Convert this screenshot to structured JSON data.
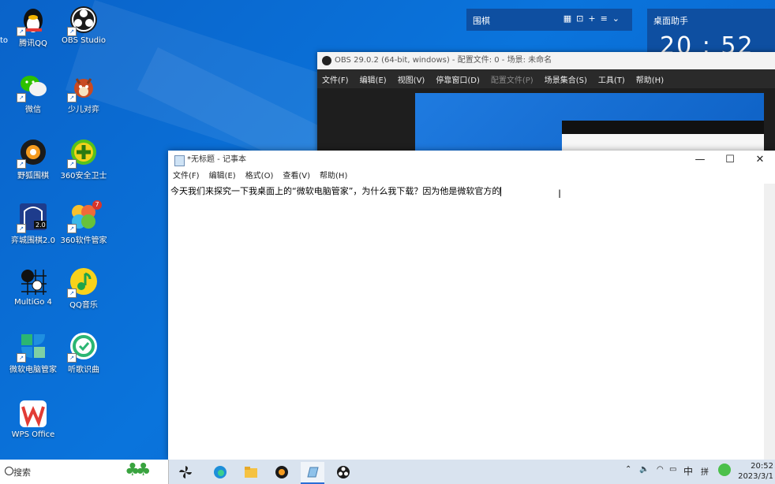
{
  "desktop": {
    "icons": [
      {
        "label": "腾讯QQ",
        "color": "#000000"
      },
      {
        "label": "OBS Studio",
        "color": "#2b2b2b"
      },
      {
        "label": "微信",
        "color": "#2dc100"
      },
      {
        "label": "少儿对弈",
        "color": "#c84a22"
      },
      {
        "label": "野狐围棋",
        "color": "#1b1b1b"
      },
      {
        "label": "360安全卫士",
        "color": "#57c21b"
      },
      {
        "label": "弈城围棋2.0",
        "color": "#1e3c8c"
      },
      {
        "label": "360软件管家",
        "color": "#ef6a3a"
      },
      {
        "label": "MultiGo 4",
        "color": "#ffffff"
      },
      {
        "label": "QQ音乐",
        "color": "#f8d21b"
      },
      {
        "label": "微软电脑管家",
        "color": "#2bb673"
      },
      {
        "label": "听歌识曲",
        "color": "#ffffff"
      },
      {
        "label": "WPS Office",
        "color": "#e23c35"
      }
    ],
    "left_edge_text": "to",
    "badge_count": "7"
  },
  "widgets": {
    "weiqi": {
      "title": "围棋"
    },
    "clock": {
      "title": "桌面助手",
      "time": "20 : 52"
    }
  },
  "obs": {
    "title": "OBS 29.0.2 (64-bit, windows) - 配置文件: 0 - 场景: 未命名",
    "menu": [
      "文件(F)",
      "编辑(E)",
      "视图(V)",
      "停靠窗口(D)",
      "配置文件(P)",
      "场景集合(S)",
      "工具(T)",
      "帮助(H)"
    ]
  },
  "notepad": {
    "title": "*无标题 - 记事本",
    "menu": [
      "文件(F)",
      "编辑(E)",
      "格式(O)",
      "查看(V)",
      "帮助(H)"
    ],
    "content": "今天我们来探究一下我桌面上的“微软电脑管家”，为什么我下载？因为他是微软官方的"
  },
  "taskbar": {
    "search_placeholder": "搜索",
    "ime": "中",
    "ime2": "拼",
    "time": "20:52",
    "date": "2023/3/1"
  }
}
